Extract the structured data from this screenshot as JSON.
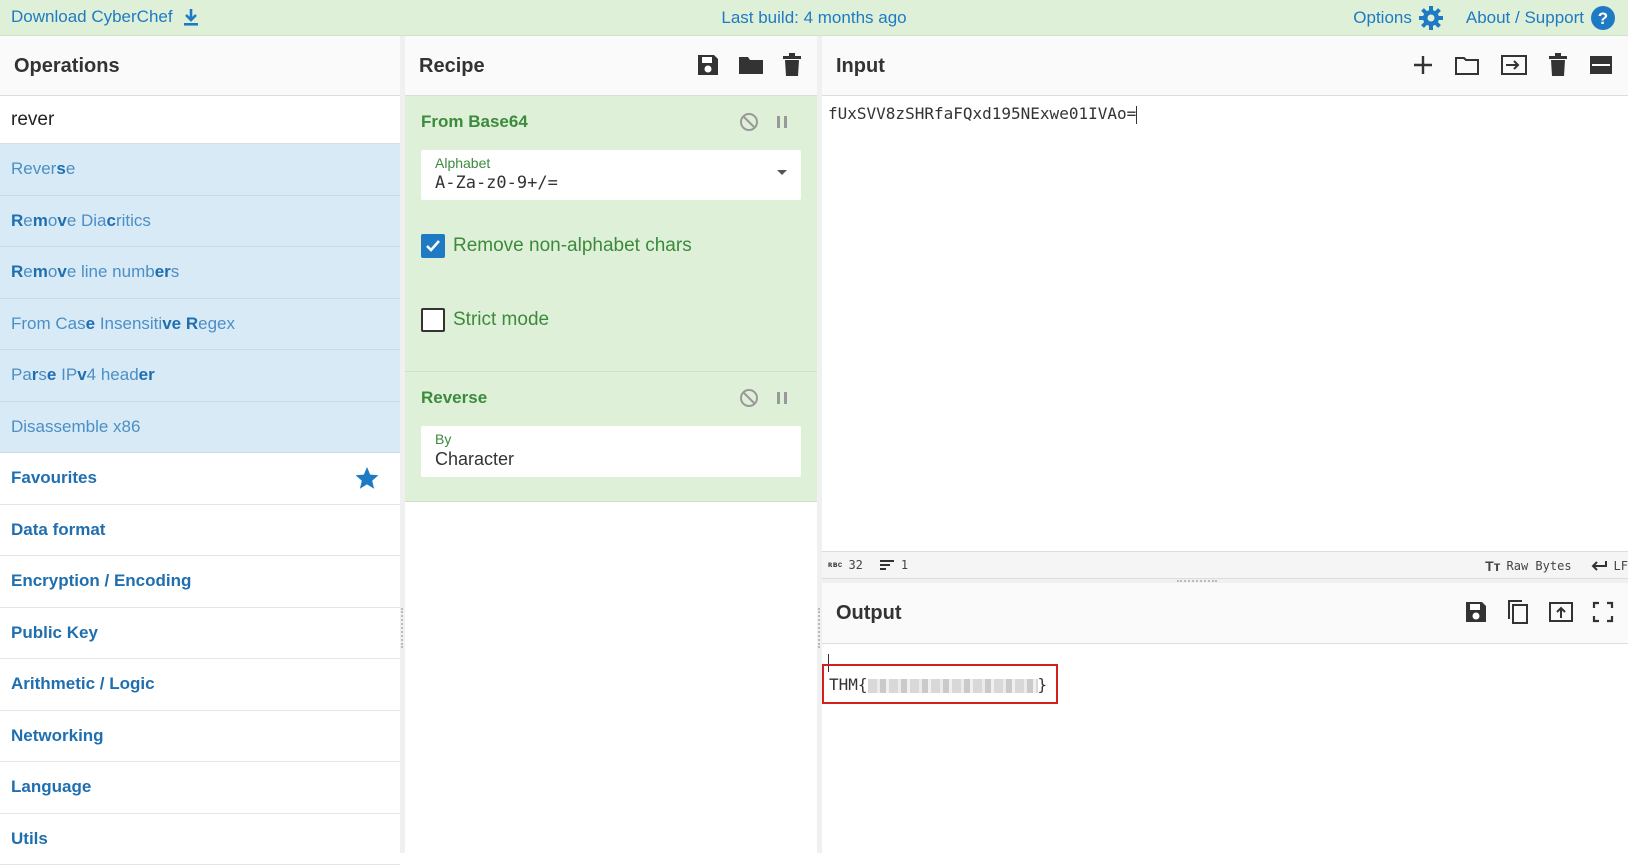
{
  "banner": {
    "download_label": "Download CyberChef",
    "build_label": "Last build: 4 months ago",
    "options_label": "Options",
    "about_label": "About / Support"
  },
  "operations": {
    "title": "Operations",
    "search_value": "rever",
    "results": [
      {
        "html": "Rever<b>s</b>e"
      },
      {
        "html": "<b>R</b>e<b>m</b>o<b>v</b>e Dia<b>c</b>ritics"
      },
      {
        "html": "<b>R</b>e<b>m</b>o<b>v</b>e line numb<b>er</b>s"
      },
      {
        "html": "From Cas<b>e</b> Insensiti<b>ve R</b>egex"
      },
      {
        "html": "Pa<b>r</b>s<b>e</b> IP<b>v</b>4 head<b>er</b>"
      },
      {
        "html": "Disassemble x86"
      }
    ],
    "categories": [
      "Favourites",
      "Data format",
      "Encryption / Encoding",
      "Public Key",
      "Arithmetic / Logic",
      "Networking",
      "Language",
      "Utils"
    ]
  },
  "recipe": {
    "title": "Recipe",
    "ingredients": {
      "from_base64": {
        "title": "From Base64",
        "alphabet_label": "Alphabet",
        "alphabet_value": "A-Za-z0-9+/=",
        "remove_label": "Remove non-alphabet chars",
        "strict_label": "Strict mode"
      },
      "reverse": {
        "title": "Reverse",
        "by_label": "By",
        "by_value": "Character"
      }
    }
  },
  "input": {
    "title": "Input",
    "value": "fUxSVV8zSHRfaFQxd195NExwe01IVAo=",
    "length": "32",
    "lines": "1",
    "encoding": "Raw Bytes",
    "eol": "LF"
  },
  "output": {
    "title": "Output",
    "prefix": "THM{",
    "suffix": "}"
  },
  "colors": {
    "accent": "#1f7ac4",
    "banner_bg": "#dff0d8",
    "highlight": "#d21f1f"
  }
}
